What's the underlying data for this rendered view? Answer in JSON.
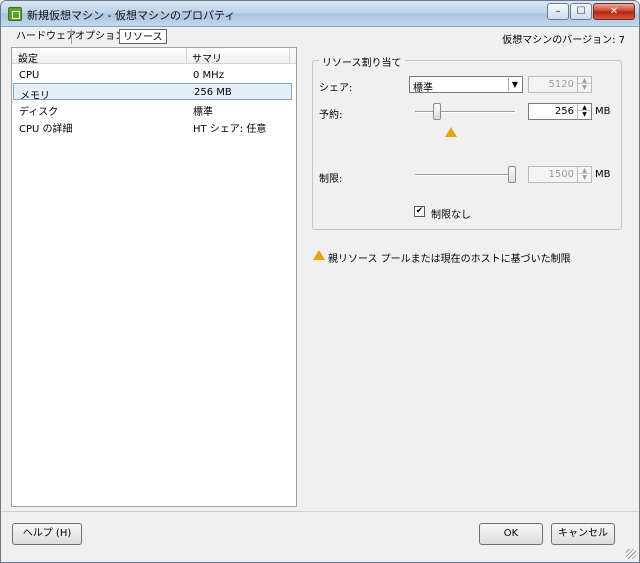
{
  "window": {
    "title": "新規仮想マシン - 仮想マシンのプロパティ",
    "min_glyph": "–",
    "max_glyph": "☐",
    "close_glyph": "✕"
  },
  "tabs": [
    {
      "label": "ハードウェア"
    },
    {
      "label": "オプション"
    },
    {
      "label": "リソース"
    }
  ],
  "vm_version": "仮想マシンのバージョン: 7",
  "settings_list": {
    "headers": {
      "setting": "設定",
      "summary": "サマリ"
    },
    "rows": [
      {
        "setting": "CPU",
        "summary": "0 MHz"
      },
      {
        "setting": "メモリ",
        "summary": "256 MB"
      },
      {
        "setting": "ディスク",
        "summary": "標準"
      },
      {
        "setting": "CPU の詳細",
        "summary": "HT シェア: 任意"
      }
    ],
    "selected_index": 1
  },
  "resource_allocation": {
    "title": "リソース割り当て",
    "shares_label": "シェア:",
    "shares_value": "標準",
    "shares_number": "5120",
    "reservation_label": "予約:",
    "reservation_value": "256",
    "reservation_unit": "MB",
    "limit_label": "制限:",
    "limit_value": "1500",
    "limit_unit": "MB",
    "unlimited_label": "制限なし",
    "unlimited_checked": true
  },
  "note": "親リソース プールまたは現在のホストに基づいた制限",
  "buttons": {
    "help": "ヘルプ (H)",
    "ok": "OK",
    "cancel": "キャンセル"
  },
  "colors": {
    "warning": "#e8a400",
    "selection": "#e6eef8"
  }
}
